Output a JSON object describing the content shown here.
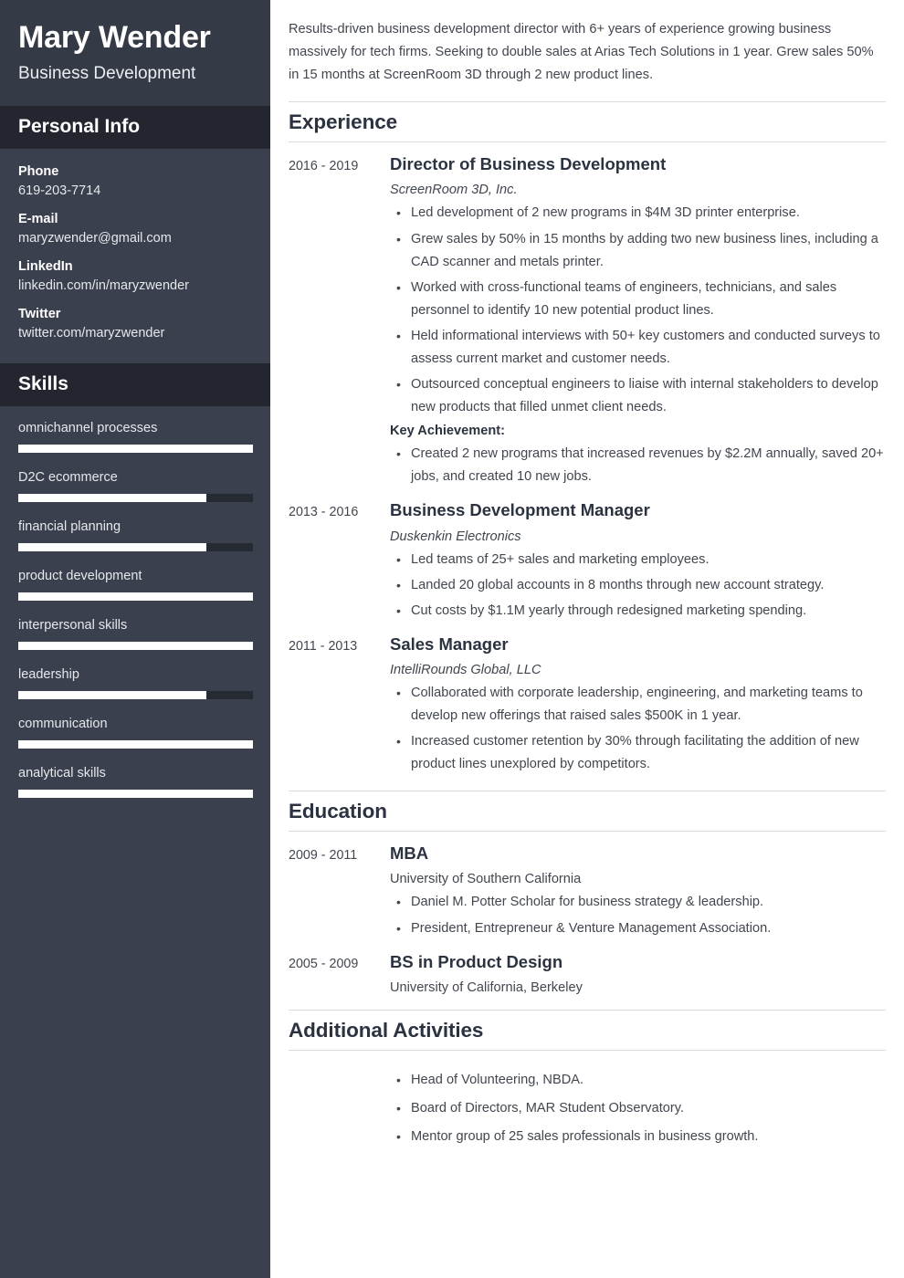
{
  "sidebar": {
    "name": "Mary Wender",
    "job_title": "Business Development",
    "personal_info_heading": "Personal Info",
    "contacts": [
      {
        "label": "Phone",
        "value": "619-203-7714"
      },
      {
        "label": "E-mail",
        "value": "maryzwender@gmail.com"
      },
      {
        "label": "LinkedIn",
        "value": "linkedin.com/in/maryzwender"
      },
      {
        "label": "Twitter",
        "value": "twitter.com/maryzwender"
      }
    ],
    "skills_heading": "Skills",
    "skills": [
      {
        "name": "omnichannel processes",
        "level": 100
      },
      {
        "name": "D2C ecommerce",
        "level": 80
      },
      {
        "name": "financial planning",
        "level": 80
      },
      {
        "name": "product development",
        "level": 100
      },
      {
        "name": "interpersonal skills",
        "level": 100
      },
      {
        "name": "leadership",
        "level": 80
      },
      {
        "name": "communication",
        "level": 100
      },
      {
        "name": "analytical skills",
        "level": 100
      }
    ],
    "colors": {
      "header_background": "#343a46",
      "band_background": "#23262f",
      "body_background": "#3a404d",
      "bar_track": "#262a33",
      "bar_fill": "#ffffff"
    }
  },
  "main": {
    "summary": "Results-driven business development director with 6+ years of experience growing business massively for tech firms. Seeking to double sales at Arias Tech Solutions in 1 year. Grew sales 50% in 15 months at ScreenRoom 3D through 2 new product lines.",
    "experience_heading": "Experience",
    "experience": [
      {
        "dates": "2016 - 2019",
        "title": "Director of Business Development",
        "org": "ScreenRoom 3D, Inc.",
        "bullets": [
          "Led development of 2 new programs in $4M 3D printer enterprise.",
          "Grew sales by 50% in 15 months by adding two new business lines, including a CAD scanner and metals printer.",
          "Worked with cross-functional teams of engineers, technicians, and sales personnel to identify 10 new potential product lines.",
          "Held informational interviews with 50+ key customers and conducted surveys to assess current market and customer needs.",
          "Outsourced conceptual engineers to liaise with internal stakeholders to develop new products that filled unmet client needs."
        ],
        "key_achievement_label": "Key Achievement:",
        "key_achievements": [
          "Created 2 new programs that increased revenues by $2.2M annually, saved 20+ jobs, and created 10 new jobs."
        ]
      },
      {
        "dates": "2013 - 2016",
        "title": "Business Development Manager",
        "org": "Duskenkin Electronics",
        "bullets": [
          "Led teams of 25+ sales and marketing employees.",
          "Landed 20 global accounts in 8 months through new account strategy.",
          "Cut costs by $1.1M yearly through redesigned marketing spending."
        ]
      },
      {
        "dates": "2011 - 2013",
        "title": "Sales Manager",
        "org": "IntelliRounds Global, LLC",
        "bullets": [
          "Collaborated with corporate leadership, engineering, and marketing teams to develop new offerings that raised sales $500K in 1 year.",
          "Increased customer retention by 30% through facilitating the addition of new product lines unexplored by competitors."
        ]
      }
    ],
    "education_heading": "Education",
    "education": [
      {
        "dates": "2009 - 2011",
        "title": "MBA",
        "org": "University of Southern California",
        "bullets": [
          "Daniel M. Potter Scholar for business strategy & leadership.",
          "President, Entrepreneur & Venture Management Association."
        ]
      },
      {
        "dates": "2005 - 2009",
        "title": "BS in Product Design",
        "org": "University of California, Berkeley",
        "bullets": []
      }
    ],
    "activities_heading": "Additional Activities",
    "activities": [
      "Head of Volunteering, NBDA.",
      "Board of Directors, MAR Student Observatory.",
      "Mentor group of 25 sales professionals in business growth."
    ]
  }
}
